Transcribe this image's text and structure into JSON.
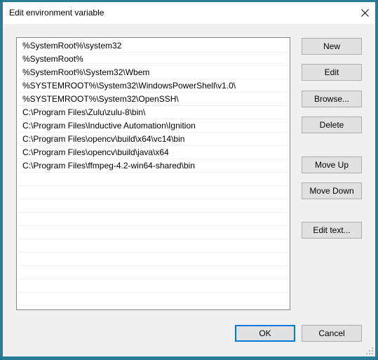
{
  "window": {
    "title": "Edit environment variable",
    "close_icon": "close-icon",
    "accent_color": "#2a7b98"
  },
  "list": {
    "items": [
      "%SystemRoot%\\system32",
      "%SystemRoot%",
      "%SystemRoot%\\System32\\Wbem",
      "%SYSTEMROOT%\\System32\\WindowsPowerShell\\v1.0\\",
      "%SYSTEMROOT%\\System32\\OpenSSH\\",
      "C:\\Program Files\\Zulu\\zulu-8\\bin\\",
      "C:\\Program Files\\Inductive Automation\\Ignition",
      "C:\\Program Files\\opencv\\build\\x64\\vc14\\bin",
      "C:\\Program Files\\opencv\\build\\java\\x64",
      "C:\\Program Files\\ffmpeg-4.2-win64-shared\\bin",
      "",
      "",
      "",
      "",
      "",
      "",
      "",
      "",
      "",
      "",
      ""
    ]
  },
  "buttons": {
    "new": "New",
    "edit": "Edit",
    "browse": "Browse...",
    "delete": "Delete",
    "move_up": "Move Up",
    "move_down": "Move Down",
    "edit_text": "Edit text...",
    "ok": "OK",
    "cancel": "Cancel"
  }
}
